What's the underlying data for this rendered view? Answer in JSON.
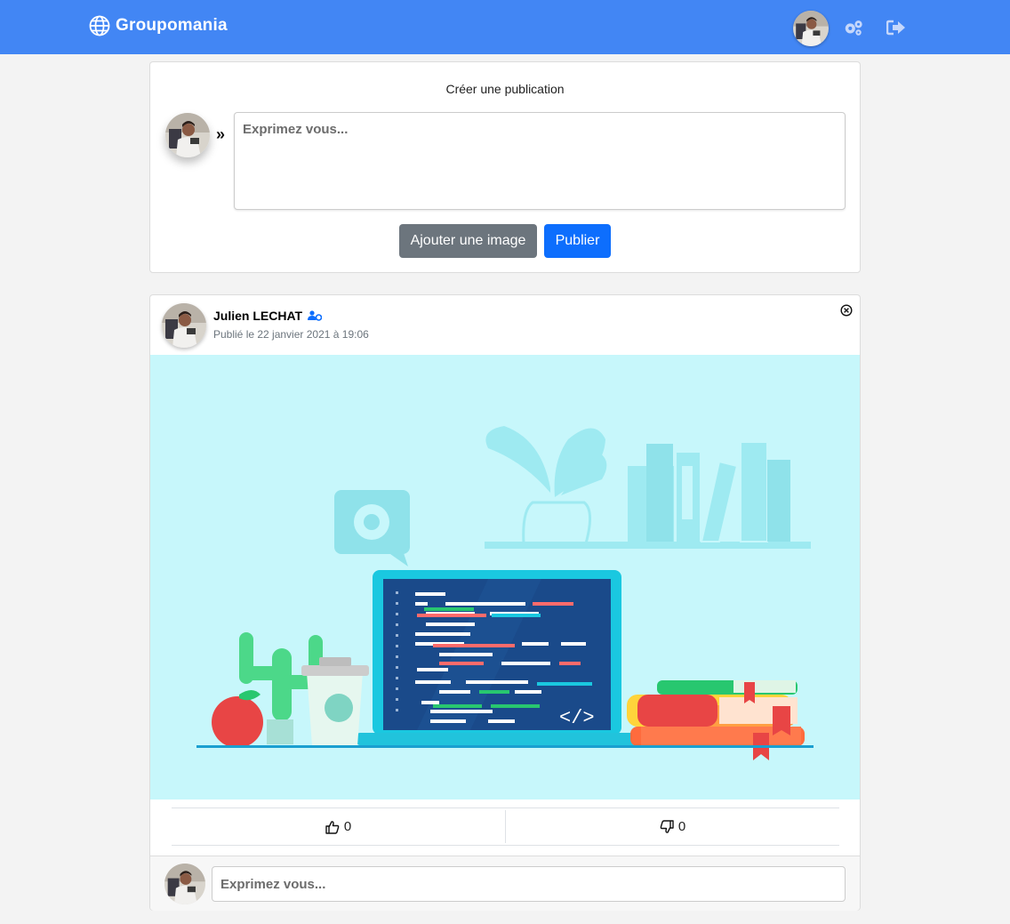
{
  "header": {
    "brand": "Groupomania",
    "icons": {
      "brand": "globe-icon",
      "settings": "gears-icon",
      "logout": "sign-out-icon"
    }
  },
  "create_post": {
    "title": "Créer une publication",
    "placeholder": "Exprimez vous...",
    "add_image_label": "Ajouter une image",
    "publish_label": "Publier",
    "chevron": "»"
  },
  "post": {
    "author": "Julien LECHAT",
    "author_badge": "user-cog-icon",
    "date": "Publié le 22 janvier 2021 à 19:06",
    "likes": "0",
    "dislikes": "0",
    "comment_placeholder": "Exprimez vous..."
  },
  "colors": {
    "primary": "#4286f4",
    "button_primary": "#0d6efd",
    "button_secondary": "#6c757d",
    "image_bg": "#c7f7fb"
  }
}
